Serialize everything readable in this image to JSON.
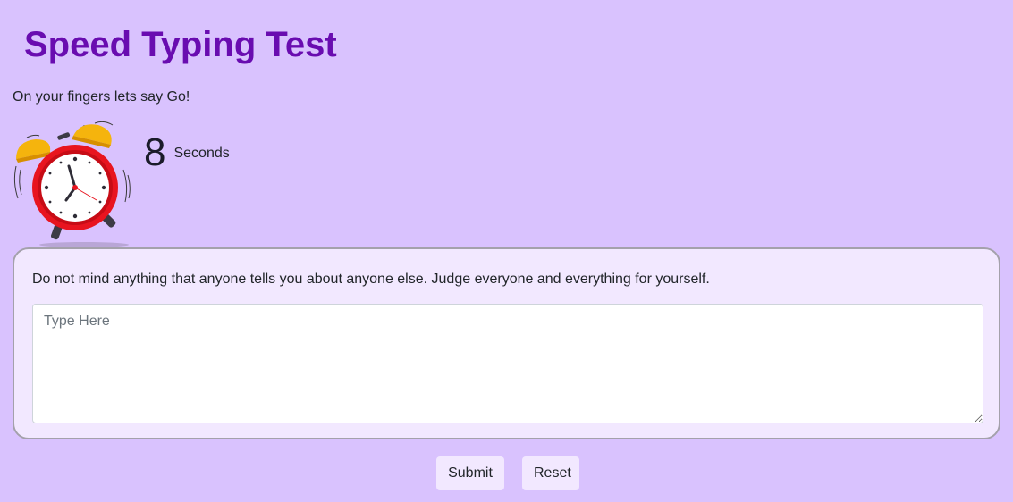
{
  "header": {
    "title": "Speed Typing Test",
    "subtitle": "On your fingers lets say Go!"
  },
  "timer": {
    "icon": "alarm-clock-icon",
    "value": "8",
    "unit": "Seconds"
  },
  "test": {
    "quote": "Do not mind anything that anyone tells you about anyone else. Judge everyone and everything for yourself.",
    "input_value": "",
    "input_placeholder": "Type Here"
  },
  "actions": {
    "submit_label": "Submit",
    "reset_label": "Reset"
  },
  "colors": {
    "background": "#d9c2fe",
    "heading": "#690cb0",
    "card": "#f2e8ff",
    "clock_red": "#e8141f",
    "clock_bell": "#f5b40d"
  }
}
